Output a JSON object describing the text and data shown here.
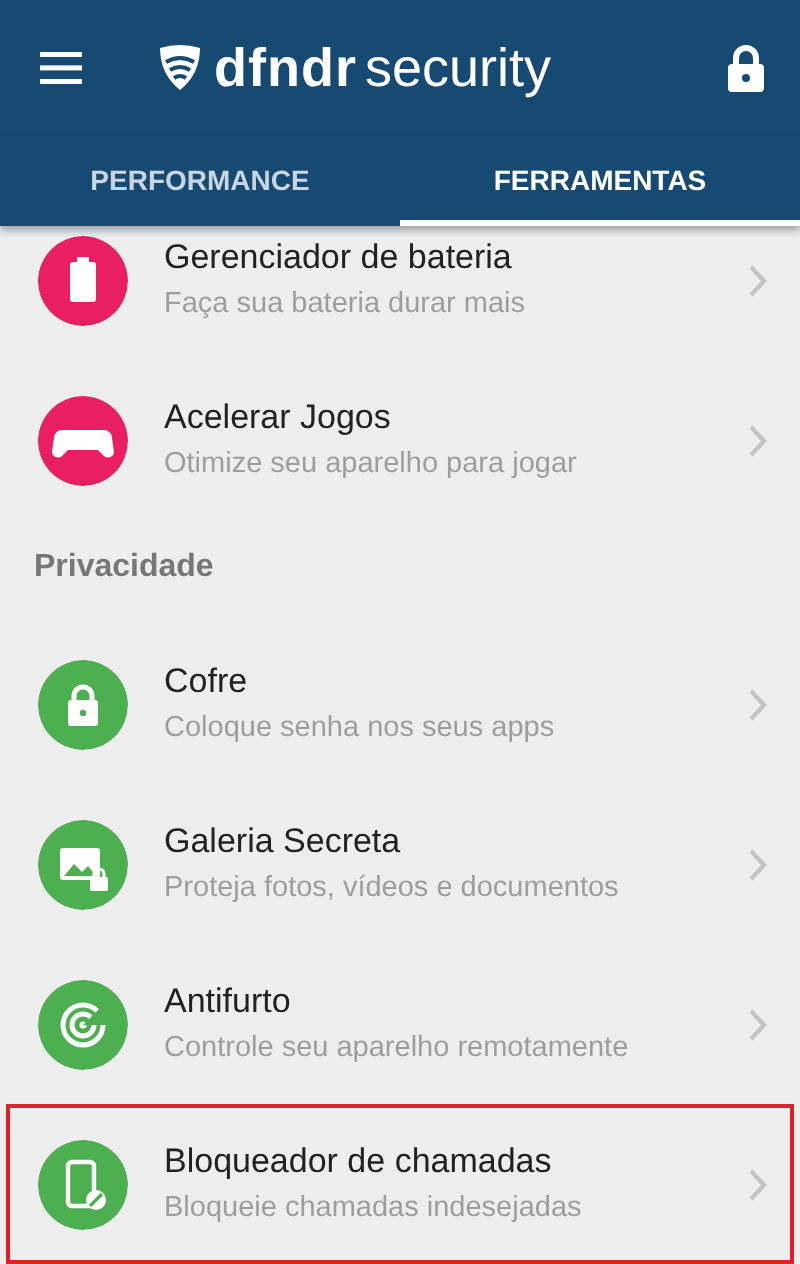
{
  "app_bar": {
    "brand_bold": "dfndr",
    "brand_light": "security"
  },
  "tabs": [
    {
      "label": "PERFORMANCE",
      "selected": false
    },
    {
      "label": "FERRAMENTAS",
      "selected": true
    }
  ],
  "sections": [
    {
      "items": [
        {
          "kind": "battery",
          "color": "#e91e63",
          "title": "Gerenciador de bateria",
          "subtitle": "Faça sua bateria durar mais",
          "highlighted": false
        },
        {
          "kind": "gamepad",
          "color": "#e91e63",
          "title": "Acelerar Jogos",
          "subtitle": "Otimize seu aparelho para jogar",
          "highlighted": false
        }
      ]
    },
    {
      "title": "Privacidade",
      "items": [
        {
          "kind": "lock",
          "color": "#4caf50",
          "title": "Cofre",
          "subtitle": "Coloque senha nos seus apps",
          "highlighted": false
        },
        {
          "kind": "gallery",
          "color": "#4caf50",
          "title": "Galeria Secreta",
          "subtitle": "Proteja fotos, vídeos e documentos",
          "highlighted": false
        },
        {
          "kind": "radar",
          "color": "#4caf50",
          "title": "Antifurto",
          "subtitle": "Controle seu aparelho remotamente",
          "highlighted": false
        },
        {
          "kind": "callblock",
          "color": "#4caf50",
          "title": "Bloqueador de chamadas",
          "subtitle": "Bloqueie chamadas indesejadas",
          "highlighted": true
        }
      ]
    }
  ]
}
